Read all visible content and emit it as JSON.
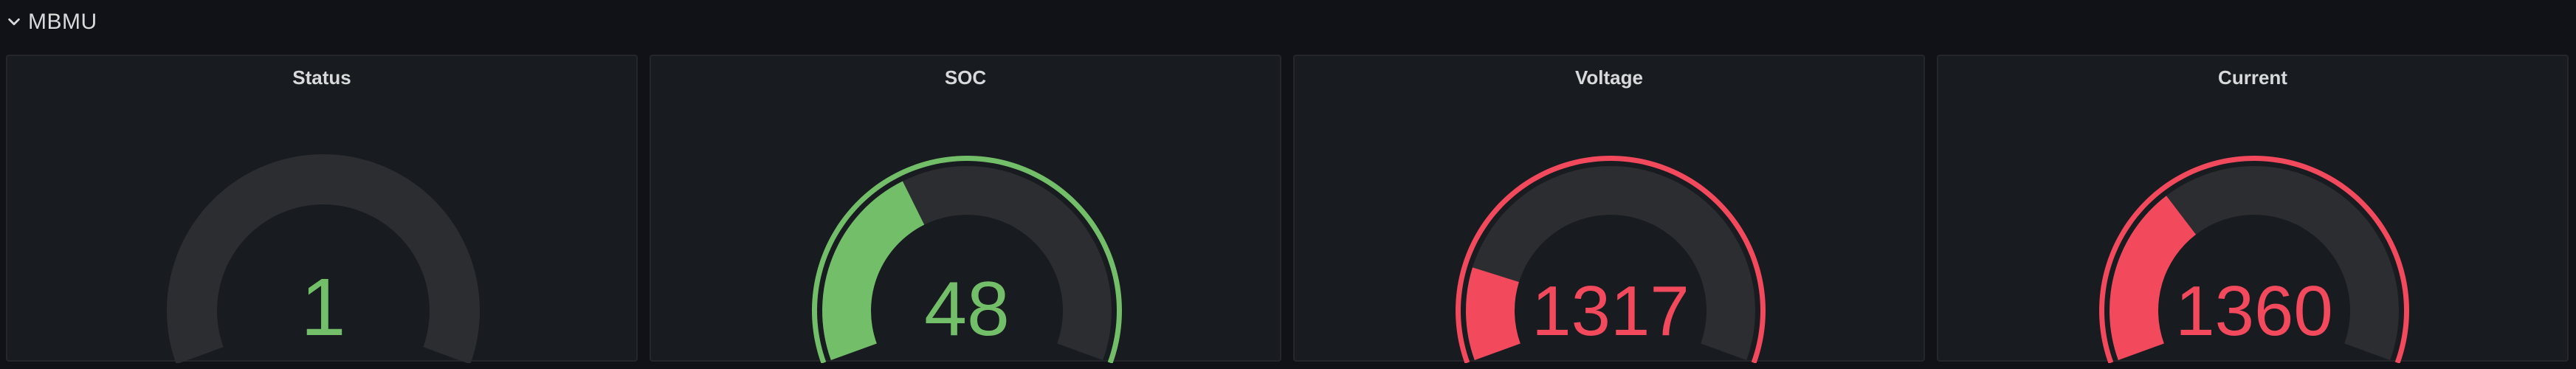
{
  "row": {
    "title": "MBMU",
    "collapse_icon": "chevron-down-icon"
  },
  "panels": [
    {
      "title": "Status",
      "value": "1",
      "value_color": "#73bf69",
      "fill_fraction": 0,
      "fill_color": "#73bf69",
      "threshold_color": null
    },
    {
      "title": "SOC",
      "value": "48",
      "value_color": "#73bf69",
      "fill_fraction": 0.38,
      "fill_color": "#73bf69",
      "threshold_color": "#73bf69"
    },
    {
      "title": "Voltage",
      "value": "1317",
      "value_color": "#f2495c",
      "fill_fraction": 0.17,
      "fill_color": "#f2495c",
      "threshold_color": "#f2495c"
    },
    {
      "title": "Current",
      "value": "1360",
      "value_color": "#f2495c",
      "fill_fraction": 0.33,
      "fill_color": "#f2495c",
      "threshold_color": "#f2495c"
    }
  ],
  "colors": {
    "background": "#111217",
    "panel_background": "#181b1f",
    "gauge_track": "#2c2d31",
    "green": "#73bf69",
    "red": "#f2495c"
  }
}
